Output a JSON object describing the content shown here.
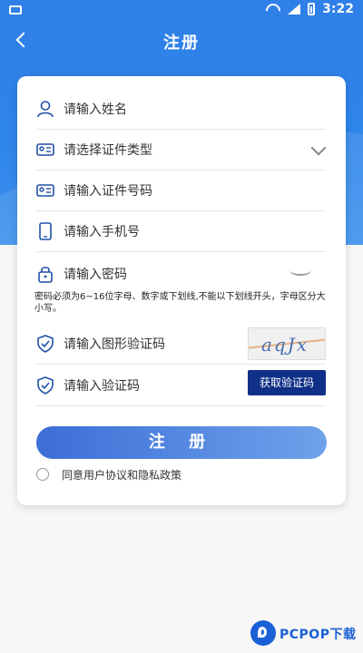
{
  "status_bar": {
    "time": "3:22"
  },
  "app_bar": {
    "title": "注册"
  },
  "form": {
    "name_placeholder": "请输入姓名",
    "id_type_placeholder": "请选择证件类型",
    "id_number_placeholder": "请输入证件号码",
    "phone_placeholder": "请输入手机号",
    "password_placeholder": "请输入密码",
    "password_hint": "密码必须为6~16位字母、数字或下划线,不能以下划线开头，字母区分大小写。",
    "image_captcha_placeholder": "请输入图形验证码",
    "captcha_image_text": "aqJx",
    "sms_code_placeholder": "请输入验证码",
    "get_code_button": "获取验证码",
    "submit_button": "注 册",
    "agreement_text": "同意用户协议和隐私政策"
  },
  "watermark": {
    "text": "PCPOP下载"
  },
  "colors": {
    "header_blue": "#2f7fe8",
    "button_dark_blue": "#0f2f88",
    "submit_gradient_start": "#3c6ed7",
    "submit_gradient_end": "#6ea2ea"
  }
}
